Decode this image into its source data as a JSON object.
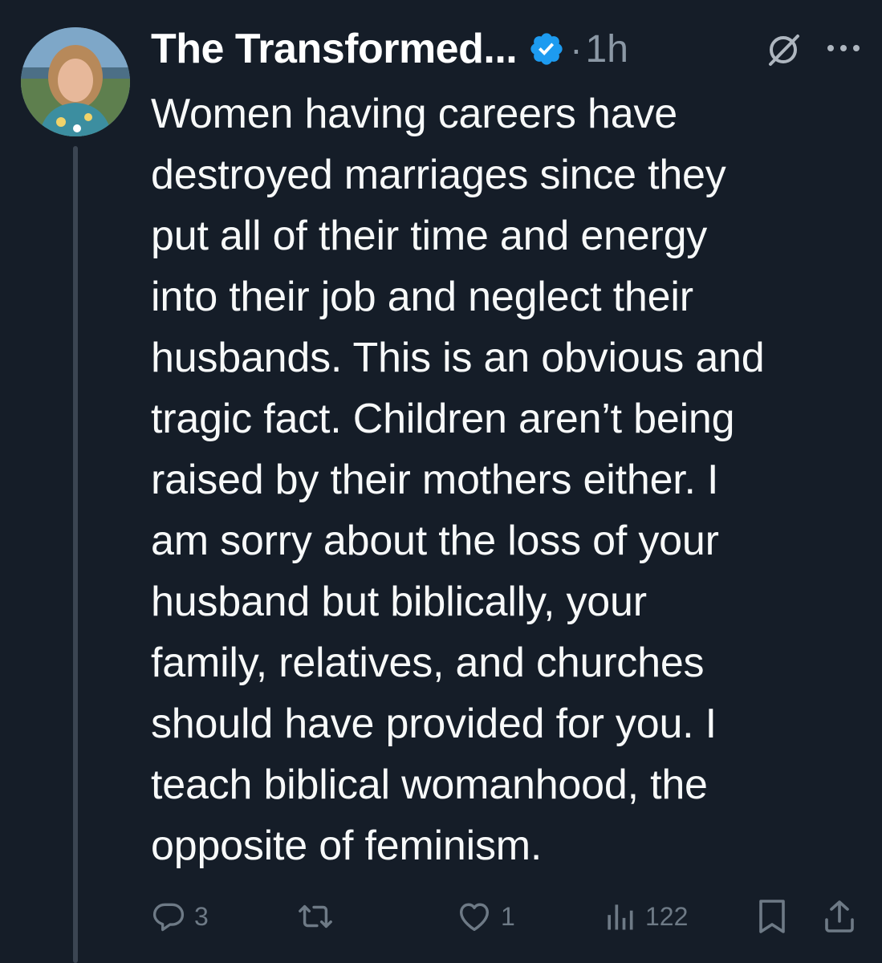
{
  "author": {
    "display_name": "The Transformed...",
    "verified": true,
    "separator": "·",
    "time": "1h"
  },
  "icons": {
    "verified": "verified-badge-icon",
    "grok": "grok-icon",
    "more": "more-options-icon",
    "reply": "reply-icon",
    "retweet": "retweet-icon",
    "like": "heart-icon",
    "views": "views-chart-icon",
    "bookmark": "bookmark-icon",
    "share": "share-icon"
  },
  "tweet": {
    "text": "Women having careers have\ndestroyed marriages since they\nput all of their time and energy\ninto their job and neglect their\nhusbands. This is an obvious and\ntragic fact. Children aren’t being\nraised by their mothers either. I\nam sorry about the loss of your\nhusband but biblically, your\nfamily, relatives, and churches\nshould have provided for you. I\nteach biblical womanhood, the\nopposite of feminism."
  },
  "metrics": {
    "replies": "3",
    "retweets": "",
    "likes": "1",
    "views": "122"
  },
  "colors": {
    "background": "#151d28",
    "text": "#f7f9f9",
    "muted": "#8b98a5",
    "verified": "#1d9bf0",
    "thread_line": "#3b4552"
  }
}
